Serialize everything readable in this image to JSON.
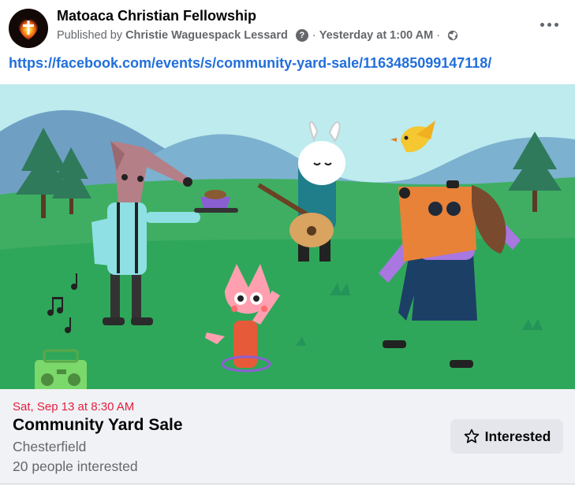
{
  "post": {
    "page_name": "Matoaca Christian Fellowship",
    "published_by_prefix": "Published by",
    "author": "Christie Waguespack Lessard",
    "help_icon_glyph": "?",
    "separator": "·",
    "timestamp": "Yesterday at 1:00 AM",
    "audience_icon": "globe-icon",
    "more_icon": "more-horizontal-icon",
    "link_url": "https://facebook.com/events/s/community-yard-sale/1163485099147118/"
  },
  "event": {
    "date_time": "Sat, Sep 13 at 8:30 AM",
    "title": "Community Yard Sale",
    "location": "Chesterfield",
    "interested_count": "20 people interested",
    "interested_label": "Interested",
    "interested_icon": "star-outline-icon"
  },
  "colors": {
    "link": "#216fdb",
    "date_accent": "#e41e3f",
    "secondary_text": "#65676b",
    "card_background": "#f0f2f5",
    "button_background": "#e4e6eb"
  }
}
